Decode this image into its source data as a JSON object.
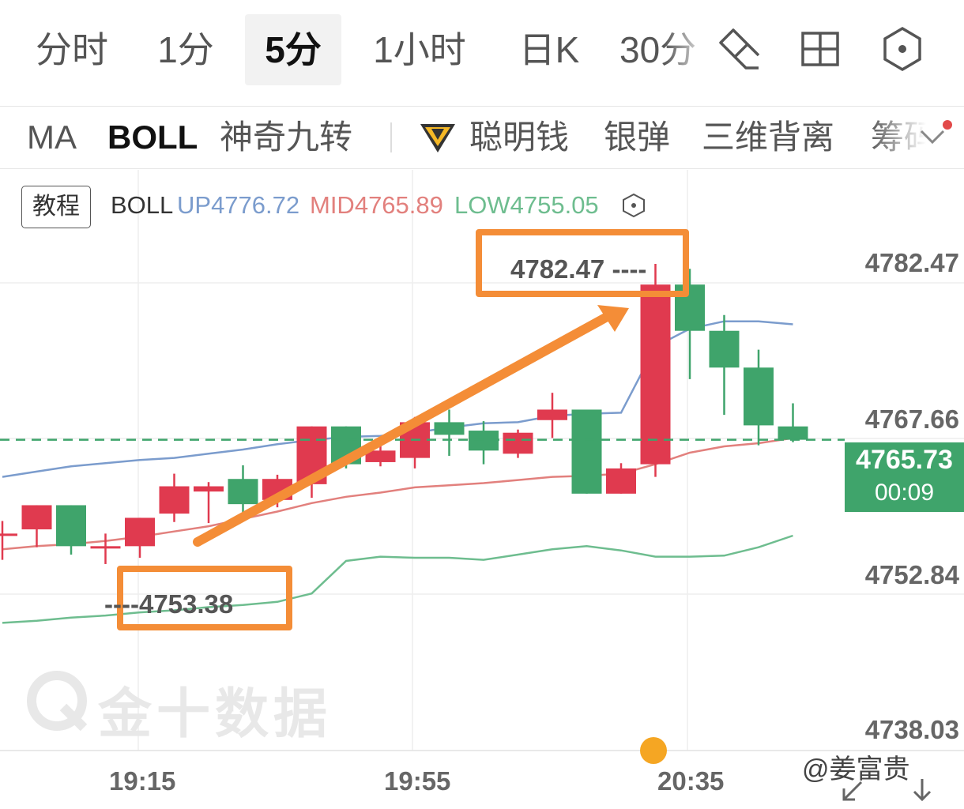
{
  "top_tabs": [
    {
      "label": "分时"
    },
    {
      "label": "1分"
    },
    {
      "label": "5分",
      "active": true
    },
    {
      "label": "1小时"
    },
    {
      "label": "日K"
    },
    {
      "label": "30分"
    }
  ],
  "top_icons": [
    "draw-pen-icon",
    "grid-layout-icon",
    "settings-hexagon-icon"
  ],
  "indicators": [
    {
      "label": "MA"
    },
    {
      "label": "BOLL",
      "active": true
    },
    {
      "label": "神奇九转"
    },
    {
      "label": "聪明钱",
      "icon": "diamond-icon"
    },
    {
      "label": "银弹"
    },
    {
      "label": "三维背离"
    },
    {
      "label": "筹码"
    }
  ],
  "legend": {
    "tutorial": "教程",
    "name": "BOLL",
    "up": "UP4776.72",
    "mid": "MID4765.89",
    "low": "LOW4755.05"
  },
  "colors": {
    "up_candle": "#e03a4f",
    "down_candle": "#3fa46b",
    "upper_band": "#7b9ccd",
    "mid_band": "#e2807d",
    "lower_band": "#6ebd8f",
    "annotation": "#f48d37"
  },
  "axis": {
    "price_labels": [
      "4782.47",
      "4767.66",
      "4752.84",
      "4738.03"
    ],
    "time_labels": [
      "19:15",
      "19:55",
      "20:35"
    ]
  },
  "current_price": {
    "value": "4765.73",
    "countdown": "00:09"
  },
  "annotations": {
    "high": "4782.47",
    "low": "4753.38"
  },
  "watermark": "金十数据",
  "credit": "@姜富贵",
  "chart_data": {
    "type": "candlestick",
    "interval": "5分",
    "ylim": [
      4735,
      4784
    ],
    "candles": [
      {
        "open": 4756.8,
        "close": 4756.8,
        "high": 4758.0,
        "low": 4754.3
      },
      {
        "open": 4757.2,
        "close": 4759.5,
        "high": 4759.5,
        "low": 4755.5
      },
      {
        "open": 4759.5,
        "close": 4755.6,
        "high": 4759.5,
        "low": 4754.8
      },
      {
        "open": 4755.6,
        "close": 4755.6,
        "high": 4756.8,
        "low": 4753.9
      },
      {
        "open": 4755.6,
        "close": 4758.3,
        "high": 4758.3,
        "low": 4754.5
      },
      {
        "open": 4758.7,
        "close": 4761.3,
        "high": 4762.5,
        "low": 4757.9
      },
      {
        "open": 4760.8,
        "close": 4761.3,
        "high": 4761.7,
        "low": 4757.8
      },
      {
        "open": 4762.0,
        "close": 4759.6,
        "high": 4763.3,
        "low": 4758.5
      },
      {
        "open": 4760.0,
        "close": 4762.0,
        "high": 4762.4,
        "low": 4759.3
      },
      {
        "open": 4761.5,
        "close": 4767.0,
        "high": 4767.0,
        "low": 4760.2
      },
      {
        "open": 4767.0,
        "close": 4763.4,
        "high": 4767.0,
        "low": 4763.0
      },
      {
        "open": 4763.6,
        "close": 4764.7,
        "high": 4765.6,
        "low": 4763.2
      },
      {
        "open": 4764.0,
        "close": 4767.4,
        "high": 4767.9,
        "low": 4763.0
      },
      {
        "open": 4767.4,
        "close": 4766.2,
        "high": 4768.6,
        "low": 4764.2
      },
      {
        "open": 4766.6,
        "close": 4764.7,
        "high": 4767.5,
        "low": 4763.4
      },
      {
        "open": 4764.4,
        "close": 4766.4,
        "high": 4766.7,
        "low": 4764.0
      },
      {
        "open": 4767.6,
        "close": 4768.6,
        "high": 4770.2,
        "low": 4765.9
      },
      {
        "open": 4768.6,
        "close": 4760.6,
        "high": 4768.6,
        "low": 4760.6
      },
      {
        "open": 4760.6,
        "close": 4763.0,
        "high": 4763.5,
        "low": 4760.6
      },
      {
        "open": 4763.4,
        "close": 4780.5,
        "high": 4782.47,
        "low": 4762.2
      },
      {
        "open": 4780.5,
        "close": 4776.1,
        "high": 4782.0,
        "low": 4771.5
      },
      {
        "open": 4776.1,
        "close": 4772.6,
        "high": 4777.6,
        "low": 4768.1
      },
      {
        "open": 4772.6,
        "close": 4767.1,
        "high": 4774.3,
        "low": 4765.2
      },
      {
        "open": 4767.0,
        "close": 4765.73,
        "high": 4769.2,
        "low": 4765.5
      }
    ],
    "upper_band": [
      4762.2,
      4762.7,
      4763.2,
      4763.5,
      4763.8,
      4764.0,
      4764.4,
      4764.8,
      4765.3,
      4765.7,
      4766.0,
      4766.1,
      4766.4,
      4766.9,
      4767.3,
      4767.4,
      4768.0,
      4768.2,
      4768.3,
      4774.6,
      4776.3,
      4777.0,
      4777.0,
      4776.72
    ],
    "mid_band": [
      4755.3,
      4755.6,
      4755.8,
      4756.1,
      4756.5,
      4757.0,
      4757.5,
      4758.2,
      4758.9,
      4759.7,
      4760.3,
      4760.7,
      4761.2,
      4761.4,
      4761.6,
      4761.9,
      4762.2,
      4762.3,
      4762.5,
      4763.4,
      4764.5,
      4765.1,
      4765.4,
      4765.89
    ],
    "lower_band": [
      4748.3,
      4748.5,
      4748.8,
      4749.0,
      4749.3,
      4749.5,
      4749.8,
      4750.0,
      4750.3,
      4751.1,
      4754.2,
      4754.6,
      4754.5,
      4754.5,
      4754.3,
      4754.8,
      4755.3,
      4755.6,
      4755.2,
      4754.6,
      4754.6,
      4754.7,
      4755.5,
      4756.6
    ],
    "time_ticks": [
      "19:15",
      "19:55",
      "20:35"
    ]
  }
}
